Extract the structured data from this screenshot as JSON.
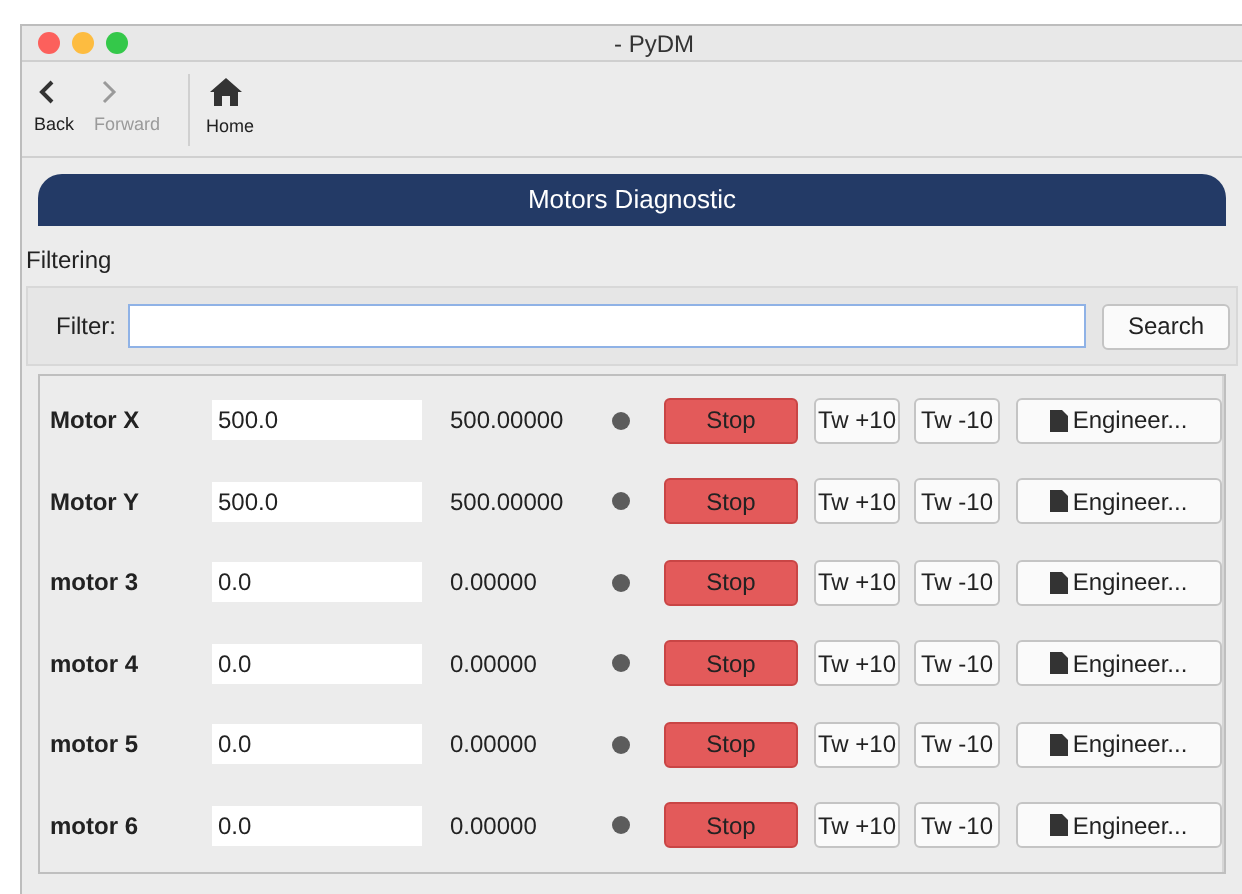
{
  "window": {
    "title": "- PyDM"
  },
  "toolbar": [
    {
      "kind": "back",
      "label": "Back",
      "disabled": false
    },
    {
      "kind": "forward",
      "label": "Forward",
      "disabled": true
    },
    {
      "kind": "home",
      "label": "Home",
      "disabled": false
    }
  ],
  "banner": {
    "title": "Motors Diagnostic"
  },
  "filtering": {
    "title": "Filtering",
    "label": "Filter:",
    "button": "Search"
  },
  "motors": [
    {
      "name": "Motor X",
      "setpoint": "500.0",
      "readback": "500.00000",
      "color": "#5c5c5c",
      "stop": "Stop",
      "tweak_plus": "Tw +10",
      "tweak_minus": "Tw -10",
      "details": "Engineer..."
    },
    {
      "name": "Motor Y",
      "setpoint": "500.0",
      "readback": "500.00000",
      "color": "#5c5c5c",
      "stop": "Stop",
      "tweak_plus": "Tw +10",
      "tweak_minus": "Tw -10",
      "details": "Engineer..."
    },
    {
      "name": "motor 3",
      "setpoint": "0.0",
      "readback": "0.00000",
      "color": "#5c5c5c",
      "stop": "Stop",
      "tweak_plus": "Tw +10",
      "tweak_minus": "Tw -10",
      "details": "Engineer..."
    },
    {
      "name": "motor 4",
      "setpoint": "0.0",
      "readback": "0.00000",
      "color": "#5c5c5c",
      "stop": "Stop",
      "tweak_plus": "Tw +10",
      "tweak_minus": "Tw -10",
      "details": "Engineer..."
    },
    {
      "name": "motor 5",
      "setpoint": "0.0",
      "readback": "0.00000",
      "color": "#5c5c5c",
      "stop": "Stop",
      "tweak_plus": "Tw +10",
      "tweak_minus": "Tw -10",
      "details": "Engineer..."
    },
    {
      "name": "motor 6",
      "setpoint": "0.0",
      "readback": "0.00000",
      "color": "#5c5c5c",
      "stop": "Stop",
      "tweak_plus": "Tw +10",
      "tweak_minus": "Tw -10",
      "details": "Engineer..."
    }
  ]
}
